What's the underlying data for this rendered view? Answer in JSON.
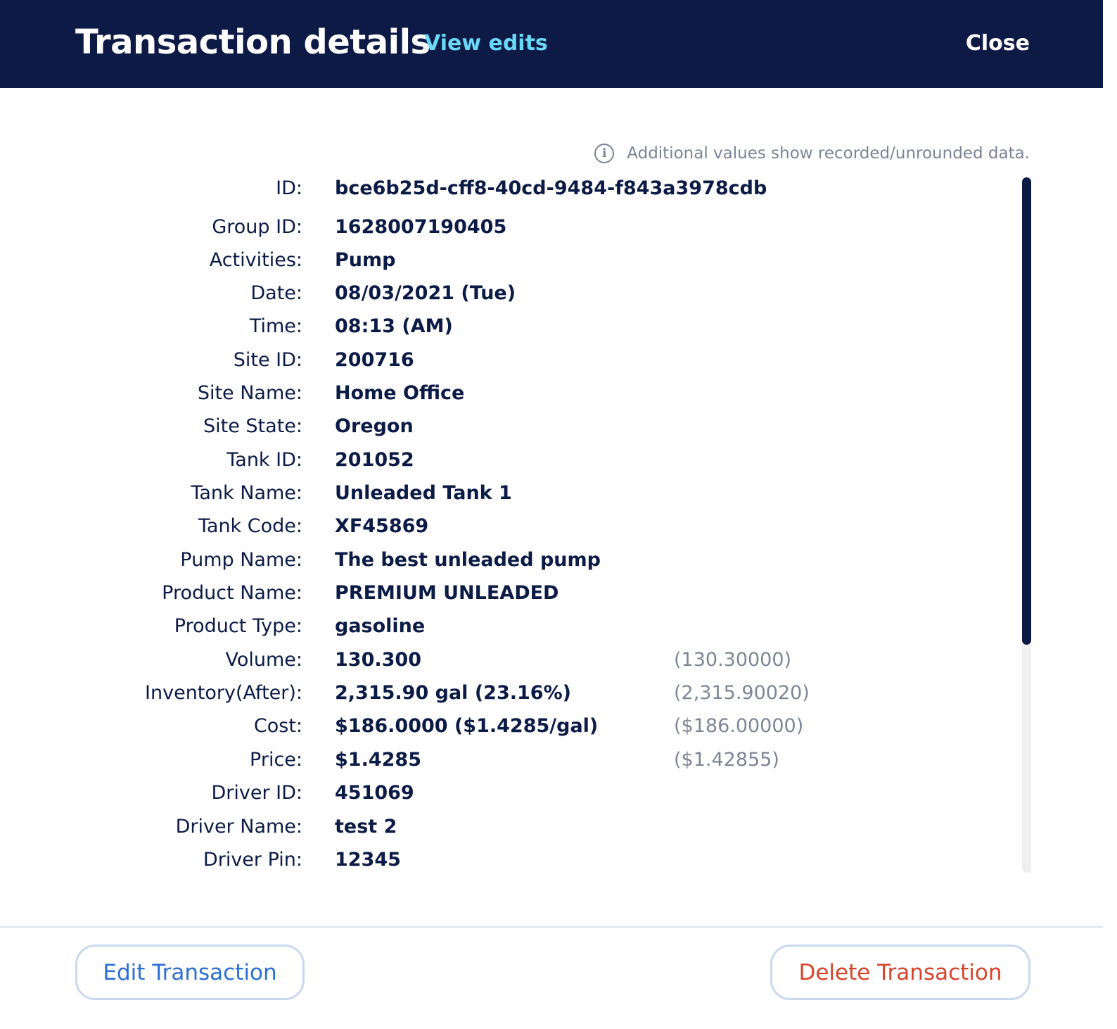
{
  "header": {
    "title": "Transaction details",
    "view_edits_label": "View edits",
    "close_label": "Close"
  },
  "note": {
    "icon": "info-icon",
    "text": "Additional values show recorded/unrounded data."
  },
  "fields": [
    {
      "label": "ID:",
      "value": "bce6b25d-cff8-40cd-9484-f843a3978cdb",
      "raw": ""
    },
    {
      "label": "Group ID:",
      "value": "1628007190405",
      "raw": ""
    },
    {
      "label": "Activities:",
      "value": "Pump",
      "raw": ""
    },
    {
      "label": "Date:",
      "value": "08/03/2021 (Tue)",
      "raw": ""
    },
    {
      "label": "Time:",
      "value": "08:13 (AM)",
      "raw": ""
    },
    {
      "label": "Site ID:",
      "value": "200716",
      "raw": ""
    },
    {
      "label": "Site Name:",
      "value": "Home Office",
      "raw": ""
    },
    {
      "label": "Site State:",
      "value": "Oregon",
      "raw": ""
    },
    {
      "label": "Tank ID:",
      "value": "201052",
      "raw": ""
    },
    {
      "label": "Tank Name:",
      "value": "Unleaded Tank 1",
      "raw": ""
    },
    {
      "label": "Tank Code:",
      "value": "XF45869",
      "raw": ""
    },
    {
      "label": "Pump Name:",
      "value": "The best unleaded pump",
      "raw": ""
    },
    {
      "label": "Product Name:",
      "value": "PREMIUM UNLEADED",
      "raw": ""
    },
    {
      "label": "Product Type:",
      "value": "gasoline",
      "raw": ""
    },
    {
      "label": "Volume:",
      "value": "130.300",
      "raw": "(130.30000)"
    },
    {
      "label": "Inventory(After):",
      "value": "2,315.90 gal (23.16%)",
      "raw": "(2,315.90020)"
    },
    {
      "label": "Cost:",
      "value": "$186.0000 ($1.4285/gal)",
      "raw": "($186.00000)"
    },
    {
      "label": "Price:",
      "value": "$1.4285",
      "raw": "($1.42855)"
    },
    {
      "label": "Driver ID:",
      "value": "451069",
      "raw": ""
    },
    {
      "label": "Driver Name:",
      "value": "test 2",
      "raw": ""
    },
    {
      "label": "Driver Pin:",
      "value": "12345",
      "raw": ""
    }
  ],
  "footer": {
    "edit_label": "Edit Transaction",
    "delete_label": "Delete Transaction"
  },
  "colors": {
    "header_bg": "#0c1a45",
    "link": "#6ad8f6",
    "edit": "#2a6fd6",
    "delete": "#d9432b"
  }
}
